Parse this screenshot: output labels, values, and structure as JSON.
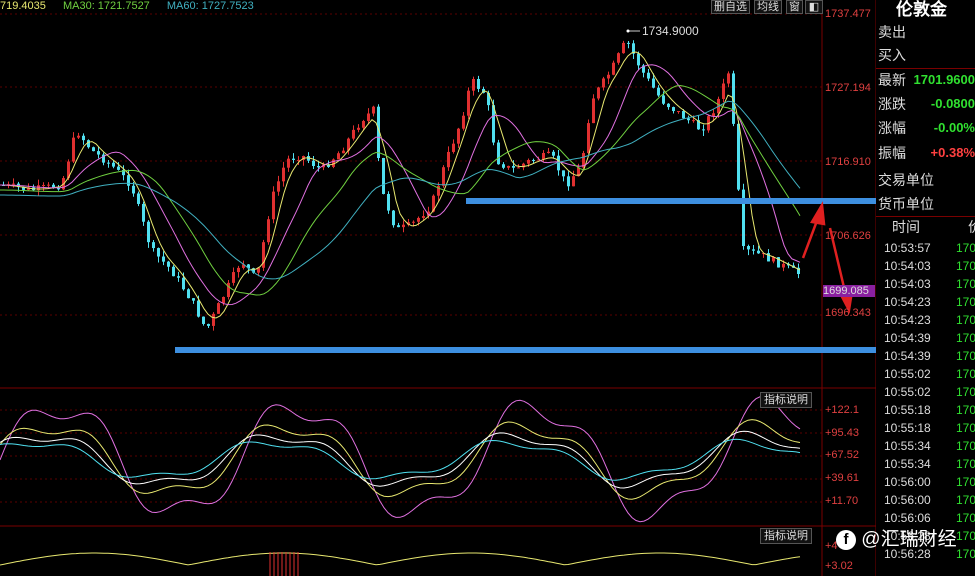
{
  "legend": {
    "ma_prev": "719.4035",
    "ma30": "MA30: 1721.7527",
    "ma60": "MA60: 1727.7523"
  },
  "toolbar": {
    "watchlist": "删自选",
    "kline": "均线",
    "window": "窗"
  },
  "price_axis": [
    "1737.477",
    "1727.194",
    "1716.910",
    "1706.626",
    "1699.085",
    "1696.343"
  ],
  "indicator_axis": [
    "+122.1",
    "+95.43",
    "+67.52",
    "+39.61",
    "+11.70"
  ],
  "indicator2_axis": [
    "+4",
    "+3.02"
  ],
  "indicator_button": "指标说明",
  "peak_label": "1734.9000",
  "side_panel": {
    "title": "伦敦金",
    "sell": "卖出",
    "buy": "买入",
    "latest_label": "最新",
    "latest_value": "1701.9600",
    "change_label": "涨跌",
    "change_value": "-0.0800",
    "change_pct_label": "涨幅",
    "change_pct_value": "-0.00%",
    "amplitude_label": "振幅",
    "amplitude_value": "+0.38%",
    "trade_unit_label": "交易单位",
    "currency_unit_label": "货币单位",
    "time_header": "时间",
    "price_header": "价",
    "ticks": [
      {
        "time": "10:53:57",
        "price": "170"
      },
      {
        "time": "10:54:03",
        "price": "170"
      },
      {
        "time": "10:54:03",
        "price": "170"
      },
      {
        "time": "10:54:23",
        "price": "170"
      },
      {
        "time": "10:54:23",
        "price": "170"
      },
      {
        "time": "10:54:39",
        "price": "170"
      },
      {
        "time": "10:54:39",
        "price": "170"
      },
      {
        "time": "10:55:02",
        "price": "170"
      },
      {
        "time": "10:55:02",
        "price": "170"
      },
      {
        "time": "10:55:18",
        "price": "170"
      },
      {
        "time": "10:55:18",
        "price": "170"
      },
      {
        "time": "10:55:34",
        "price": "170"
      },
      {
        "time": "10:55:34",
        "price": "170"
      },
      {
        "time": "10:56:00",
        "price": "170"
      },
      {
        "time": "10:56:00",
        "price": "170"
      },
      {
        "time": "10:56:06",
        "price": "170"
      },
      {
        "time": "10:56:28",
        "price": "170"
      },
      {
        "time": "10:56:28",
        "price": "170"
      }
    ]
  },
  "watermark": "@汇瑞财经",
  "colors": {
    "up": "#e03030",
    "down": "#50e0f0",
    "ma_yellow": "#e8e870",
    "ma_pink": "#e070e0",
    "ma_green": "#70d040",
    "ma_cyan": "#40b0c0",
    "support_line": "#3d8fe0",
    "axis_red": "#e04040"
  }
}
